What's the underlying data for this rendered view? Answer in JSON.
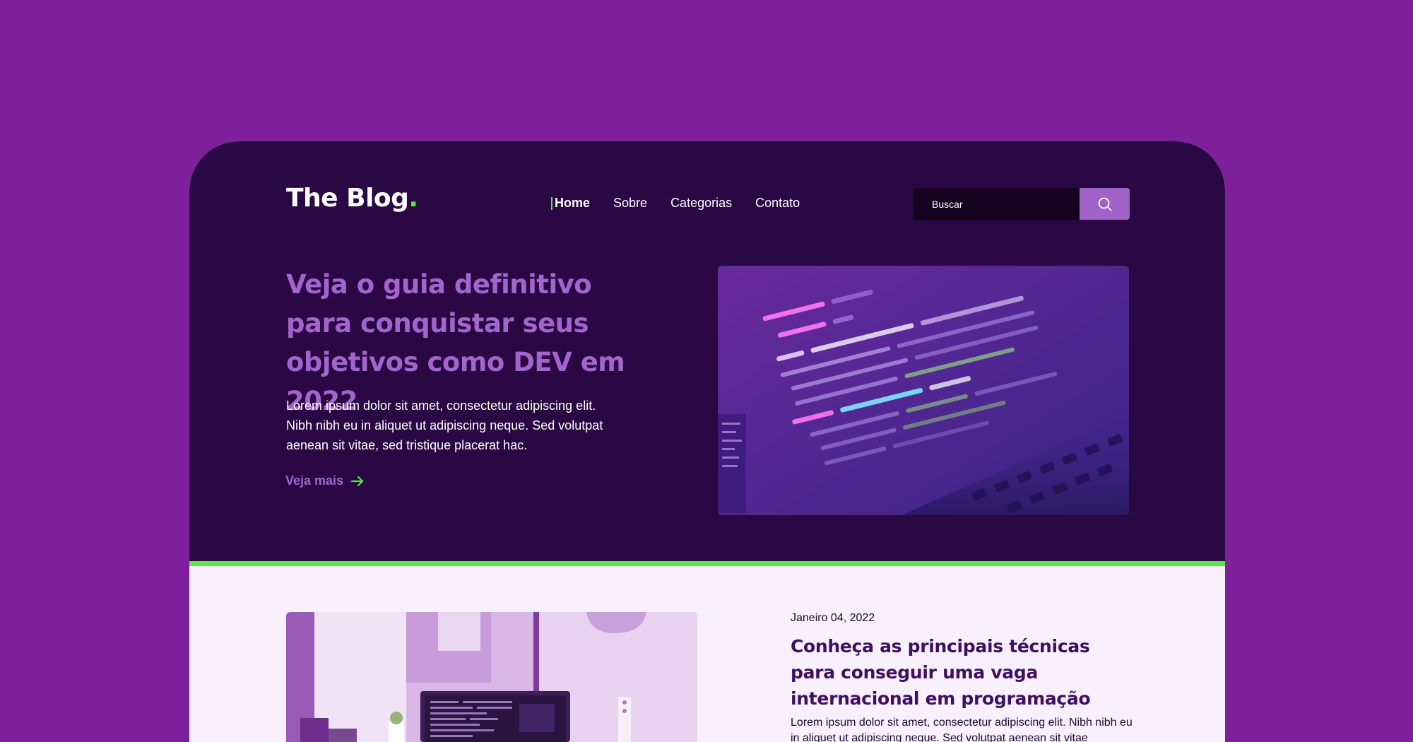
{
  "header": {
    "logo_text": "The Blog",
    "logo_dot": "."
  },
  "nav": {
    "items": [
      {
        "label": "Home",
        "active": true
      },
      {
        "label": "Sobre",
        "active": false
      },
      {
        "label": "Categorias",
        "active": false
      },
      {
        "label": "Contato",
        "active": false
      }
    ]
  },
  "search": {
    "placeholder": "Buscar",
    "icon": "search-icon"
  },
  "hero": {
    "title": "Veja o guia definitivo para conquistar seus objetivos como DEV em 2022",
    "text": "Lorem ipsum dolor sit amet, consectetur adipiscing elit. Nibh nibh eu in aliquet ut adipiscing neque. Sed volutpat aenean sit vitae, sed tristique placerat hac.",
    "link_label": "Veja mais",
    "link_icon": "arrow-right-icon"
  },
  "post": {
    "date": "Janeiro 04, 2022",
    "title": "Conheça as principais técnicas para conseguir uma vaga internacional em programação",
    "text": "Lorem ipsum dolor sit amet, consectetur adipiscing elit. Nibh nibh eu in aliquet ut adipiscing neque. Sed volutpat aenean sit vitae"
  },
  "colors": {
    "page_background": "#7E209B",
    "hero_background": "#290843",
    "accent_green": "#51EE3E",
    "accent_purple": "#A464CD",
    "search_button": "#9F62C6",
    "content_background": "#F8F0FC"
  }
}
